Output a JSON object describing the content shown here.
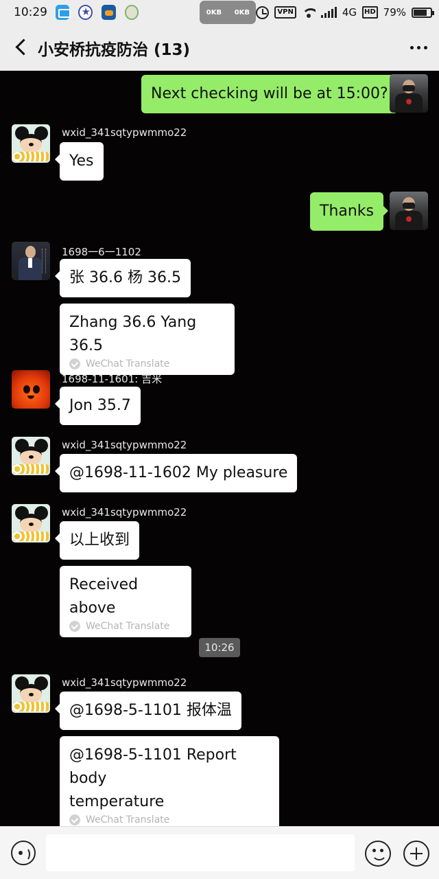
{
  "status_bar": {
    "time": "10:29",
    "speed_up": "0KB",
    "speed_down": "0KB",
    "vpn": "VPN",
    "network": "4G",
    "hd": "HD",
    "battery": "79%",
    "battery_level": 0.79,
    "app_icons": [
      "messages-icon",
      "star-app-icon",
      "download-app-icon",
      "ball-app-icon"
    ]
  },
  "header": {
    "title": "小安桥抗疫防治 (13)",
    "back_icon": "chevron-left-icon",
    "more_icon": "more-dots-icon"
  },
  "chat": {
    "messages": [
      {
        "side": "right",
        "text": "Next checking will be at 15:00?"
      },
      {
        "side": "left",
        "sender": "wxid_341sqtypwmmo22",
        "text": "Yes"
      },
      {
        "side": "right",
        "text": "Thanks"
      },
      {
        "side": "left",
        "sender": "1698一6一1102",
        "text": "张 36.6 杨 36.5",
        "translation": "Zhang 36.6 Yang 36.5"
      },
      {
        "side": "left",
        "sender": "1698-11-1601: 吉米",
        "text": "Jon 35.7"
      },
      {
        "side": "left",
        "sender": "wxid_341sqtypwmmo22",
        "text": "@1698-11-1602 My pleasure"
      },
      {
        "side": "left",
        "sender": "wxid_341sqtypwmmo22",
        "text": "以上收到",
        "translation": "Received above"
      },
      {
        "timestamp": "10:26"
      },
      {
        "side": "left",
        "sender": "wxid_341sqtypwmmo22",
        "text": "@1698-5-1101  报体温",
        "translation_lines": [
          "@1698-5-1101 Report body",
          "temperature"
        ]
      }
    ],
    "translate_label": "WeChat Translate"
  },
  "input_bar": {
    "voice_icon": "voice-icon",
    "input_value": "",
    "emoji_icon": "emoji-icon",
    "plus_icon": "plus-icon"
  },
  "colors": {
    "chat_background": "#050303",
    "outgoing_bubble": "#95ec69",
    "incoming_bubble": "#ffffff",
    "header_background": "#ededed"
  }
}
